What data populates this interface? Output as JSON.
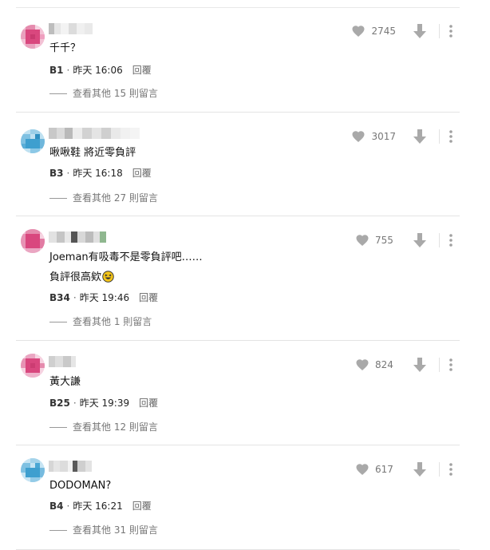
{
  "comments": [
    {
      "text_lines": [
        "千千？"
      ],
      "floor": "B1",
      "time": "昨天 16:06",
      "reply_label": "回覆",
      "likes": "2745",
      "more_replies": "查看其他 15 則留言"
    },
    {
      "text_lines": [
        "啾啾鞋 將近零負評"
      ],
      "floor": "B3",
      "time": "昨天 16:18",
      "reply_label": "回覆",
      "likes": "3017",
      "more_replies": "查看其他 27 則留言"
    },
    {
      "text_lines": [
        "Joeman有吸毒不是零負評吧……",
        "負評很高欸"
      ],
      "floor": "B34",
      "time": "昨天 19:46",
      "reply_label": "回覆",
      "likes": "755",
      "more_replies": "查看其他 1 則留言"
    },
    {
      "text_lines": [
        "黃大謙"
      ],
      "floor": "B25",
      "time": "昨天 19:39",
      "reply_label": "回覆",
      "likes": "824",
      "more_replies": "查看其他 12 則留言"
    },
    {
      "text_lines": [
        "DODOMAN?"
      ],
      "floor": "B4",
      "time": "昨天 16:21",
      "reply_label": "回覆",
      "likes": "617",
      "more_replies": "查看其他 31 則留言"
    }
  ],
  "icons": {
    "like": "heart-icon",
    "dislike": "arrow-down-icon",
    "more": "more-vertical-icon",
    "emoji": "grinning-squinting-face-emoji"
  },
  "colors": {
    "icon_gray": "#a9a9a9",
    "text": "#111111",
    "muted": "#777777",
    "divider": "#e4e4e4",
    "avatar_pink": "#d9477e",
    "avatar_blue": "#3e9fcf",
    "emoji_yellow": "#f5c518"
  }
}
